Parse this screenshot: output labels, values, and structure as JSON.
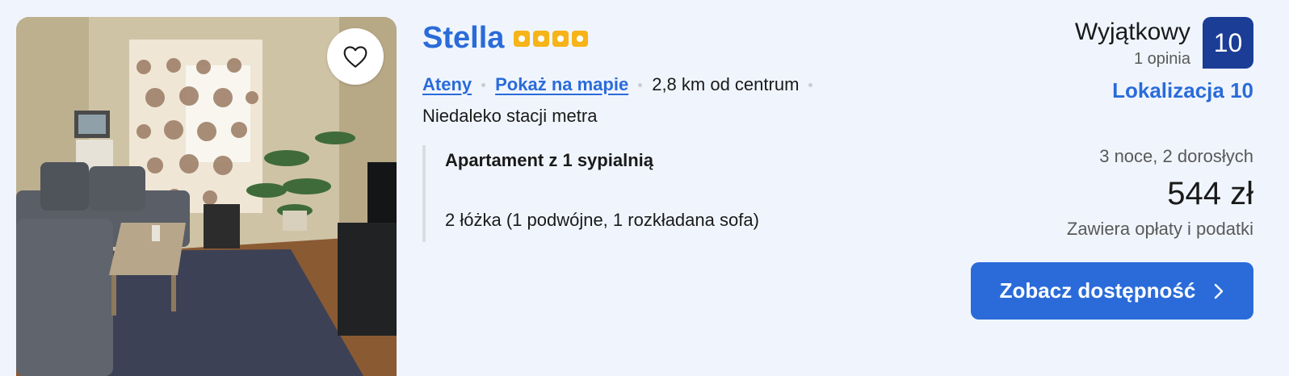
{
  "hotel": {
    "name": "Stella",
    "star_count": 4,
    "star_color": "#f6b419",
    "favorite_icon": "heart-outline-icon"
  },
  "location": {
    "city_link": "Ateny",
    "map_link": "Pokaż na mapie",
    "distance": "2,8 km od centrum",
    "note": "Niedaleko stacji metra"
  },
  "room": {
    "name": "Apartament z 1 sypialnią",
    "beds": "2 łóżka (1 podwójne, 1 rozkładana sofa)"
  },
  "rating": {
    "word": "Wyjątkowy",
    "reviews": "1 opinia",
    "score": "10",
    "location_score": "Lokalizacja 10",
    "badge_color": "#1b3d96"
  },
  "pricing": {
    "stay": "3 noce, 2 dorosłych",
    "price": "544 zł",
    "taxes": "Zawiera opłaty i podatki"
  },
  "cta": {
    "label": "Zobacz dostępność",
    "icon": "chevron-right-icon",
    "color": "#2a6bd9"
  },
  "colors": {
    "background": "#f0f5fd",
    "link": "#2a6bd9"
  }
}
